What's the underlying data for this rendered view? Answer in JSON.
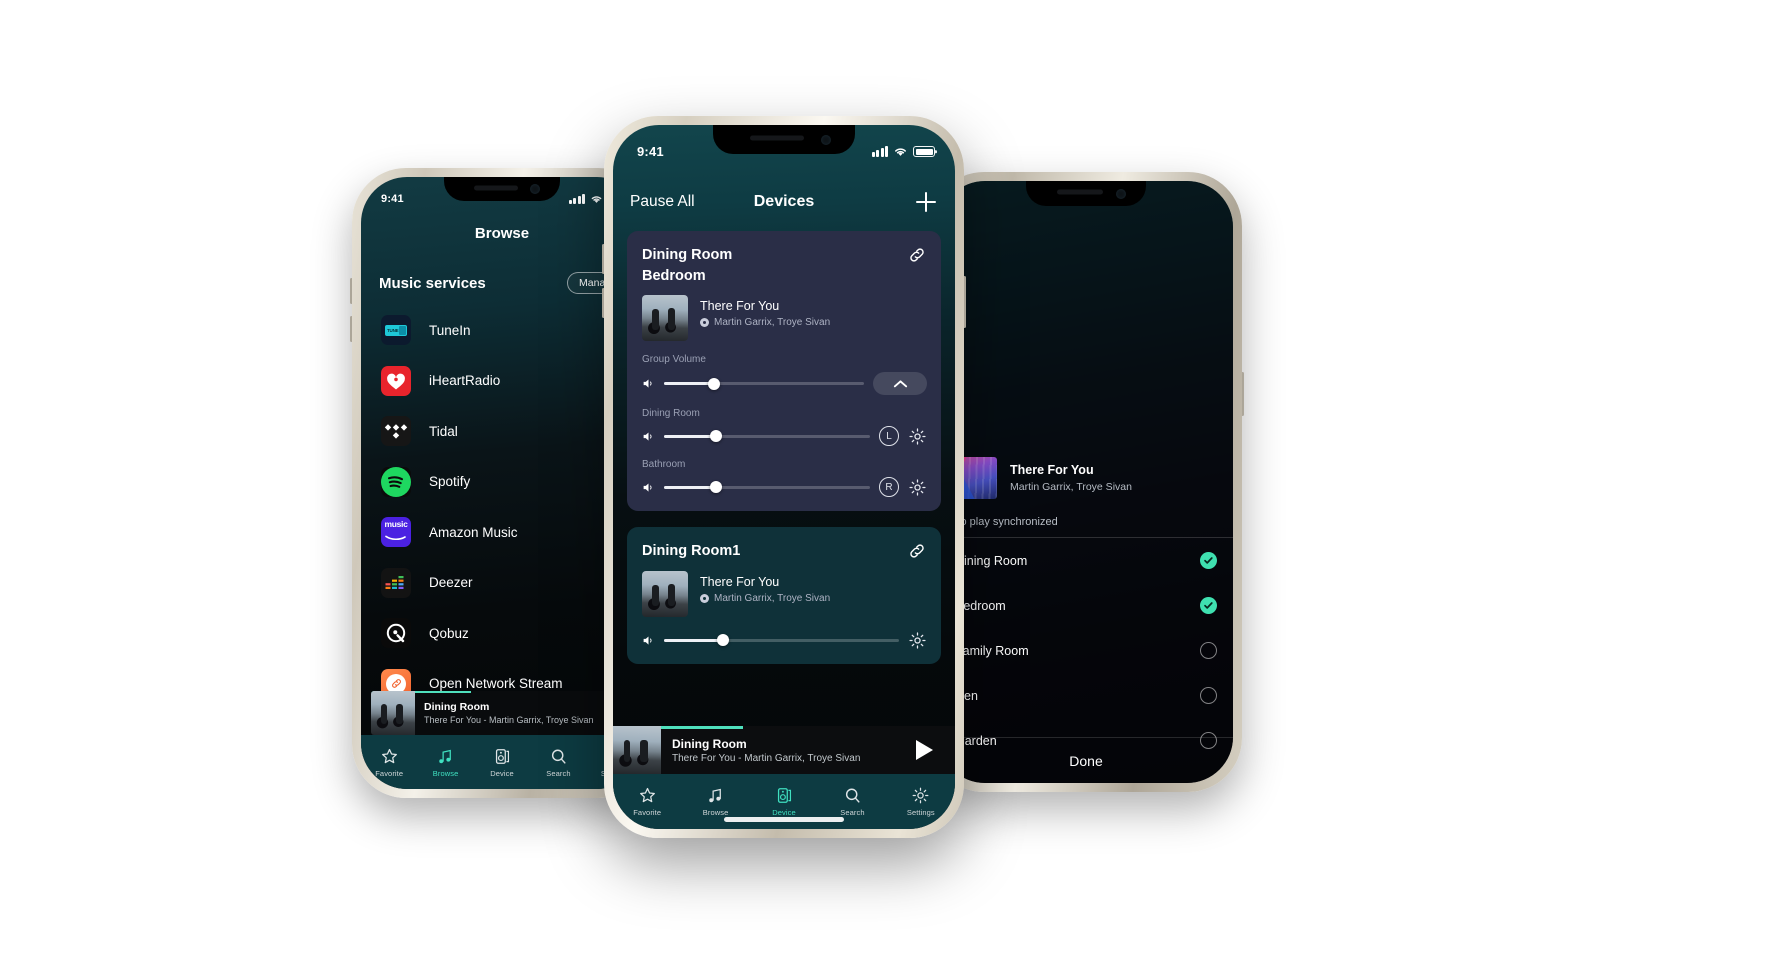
{
  "phone_left": {
    "status": {
      "time": "9:41"
    },
    "nav_title": "Browse",
    "section": {
      "title": "Music services",
      "manage_label": "Manage"
    },
    "services": [
      {
        "name": "TuneIn",
        "icon": "tunein-icon"
      },
      {
        "name": "iHeartRadio",
        "icon": "iheartradio-icon"
      },
      {
        "name": "Tidal",
        "icon": "tidal-icon"
      },
      {
        "name": "Spotify",
        "icon": "spotify-icon"
      },
      {
        "name": "Amazon Music",
        "icon": "amazon-music-icon"
      },
      {
        "name": "Deezer",
        "icon": "deezer-icon"
      },
      {
        "name": "Qobuz",
        "icon": "qobuz-icon"
      },
      {
        "name": "Open Network Stream",
        "icon": "open-network-stream-icon"
      }
    ],
    "mini_player": {
      "room": "Dining Room",
      "subtitle": "There For You - Martin Garrix, Troye Sivan",
      "progress_pct": 38
    },
    "tabs": [
      {
        "label": "Favorite",
        "icon": "star-icon",
        "active": false
      },
      {
        "label": "Browse",
        "icon": "music-note-icon",
        "active": true
      },
      {
        "label": "Device",
        "icon": "speaker-icon",
        "active": false
      },
      {
        "label": "Search",
        "icon": "search-icon",
        "active": false
      },
      {
        "label": "Settings",
        "icon": "gear-icon",
        "active": false
      }
    ]
  },
  "phone_center": {
    "status": {
      "time": "9:41"
    },
    "nav": {
      "left_action": "Pause All",
      "title": "Devices",
      "add_icon": "plus-icon"
    },
    "cards": [
      {
        "type": "group",
        "names": [
          "Dining Room",
          "Bedroom"
        ],
        "link_icon": "link-icon",
        "track": {
          "title": "There For You",
          "artist": "Martin Garrix, Troye Sivan"
        },
        "sliders": [
          {
            "label": "Group Volume",
            "value_pct": 25,
            "trailing": "chevron-up-pill"
          },
          {
            "label": "Dining Room",
            "value_pct": 25,
            "trailing": "L",
            "gear": true
          },
          {
            "label": "Bathroom",
            "value_pct": 25,
            "trailing": "R",
            "gear": true
          }
        ]
      },
      {
        "type": "single",
        "names": [
          "Dining Room1"
        ],
        "link_icon": "link-icon",
        "track": {
          "title": "There For You",
          "artist": "Martin Garrix, Troye Sivan"
        },
        "sliders": [
          {
            "label": "",
            "value_pct": 25,
            "gear": true
          }
        ]
      }
    ],
    "mini_player": {
      "room": "Dining Room",
      "subtitle": "There For You - Martin Garrix, Troye Sivan",
      "progress_pct": 38,
      "play_icon": "play-icon"
    },
    "tabs": [
      {
        "label": "Favorite",
        "icon": "star-icon",
        "active": false
      },
      {
        "label": "Browse",
        "icon": "music-note-icon",
        "active": false
      },
      {
        "label": "Device",
        "icon": "speaker-icon",
        "active": true
      },
      {
        "label": "Search",
        "icon": "search-icon",
        "active": false
      },
      {
        "label": "Settings",
        "icon": "gear-icon",
        "active": false
      }
    ]
  },
  "phone_right": {
    "now_playing": {
      "title": "There For You",
      "artist": "Martin Garrix, Troye Sivan"
    },
    "sync_label": "To play synchronized",
    "rooms": [
      {
        "name": "Dining Room",
        "selected": true
      },
      {
        "name": "Bedroom",
        "selected": true
      },
      {
        "name": "Family Room",
        "selected": false
      },
      {
        "name": "Den",
        "selected": false
      },
      {
        "name": "Garden",
        "selected": false
      }
    ],
    "done_label": "Done"
  },
  "colors": {
    "accent_teal": "#3fe0c0",
    "check_green": "#3fe0b0",
    "group_card": "#2a2e47",
    "single_card": "#0f3139",
    "tabbar": "#0d3b42"
  }
}
